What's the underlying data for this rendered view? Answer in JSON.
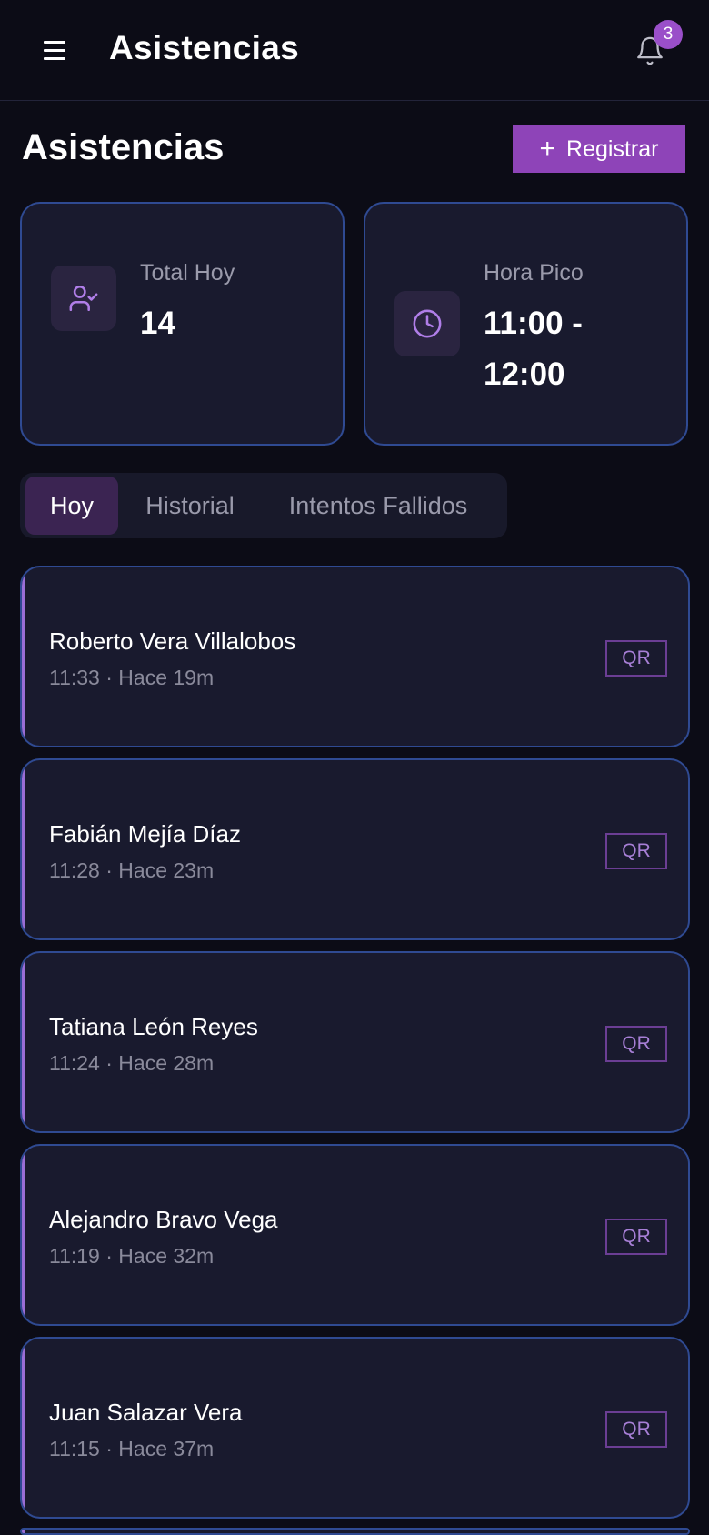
{
  "header": {
    "title": "Asistencias",
    "notifications_count": "3"
  },
  "page": {
    "title": "Asistencias",
    "register_label": "Registrar"
  },
  "stats": {
    "total": {
      "label": "Total Hoy",
      "value": "14",
      "icon": "user-check-icon"
    },
    "peak": {
      "label": "Hora Pico",
      "value": "11:00 - 12:00",
      "icon": "clock-icon"
    }
  },
  "tabs": [
    {
      "label": "Hoy",
      "active": true
    },
    {
      "label": "Historial",
      "active": false
    },
    {
      "label": "Intentos Fallidos",
      "active": false
    }
  ],
  "attendance": [
    {
      "name": "Roberto Vera Villalobos",
      "meta": "11:33 · Hace 19m",
      "method": "QR"
    },
    {
      "name": "Fabián Mejía Díaz",
      "meta": "11:28 · Hace 23m",
      "method": "QR"
    },
    {
      "name": "Tatiana León Reyes",
      "meta": "11:24 · Hace 28m",
      "method": "QR"
    },
    {
      "name": "Alejandro Bravo Vega",
      "meta": "11:19 · Hace 32m",
      "method": "QR"
    },
    {
      "name": "Juan Salazar Vera",
      "meta": "11:15 · Hace 37m",
      "method": "QR"
    }
  ],
  "colors": {
    "background": "#0c0c16",
    "card": "#191a2e",
    "card_border": "#2f4a92",
    "accent": "#8e44b8",
    "icon_accent": "#b07ee8"
  }
}
